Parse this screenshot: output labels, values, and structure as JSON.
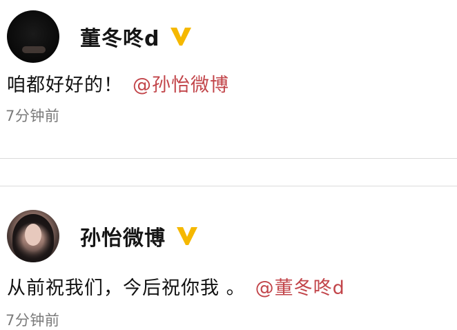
{
  "posts": [
    {
      "author": "董冬咚d",
      "verified_icon": "v-badge-icon",
      "text": "咱都好好的！",
      "mention": "@孙怡微博",
      "time": "7分钟前"
    },
    {
      "author": "孙怡微博",
      "verified_icon": "v-badge-icon",
      "text": "从前祝我们，今后祝你我 。",
      "mention": "@董冬咚d",
      "time": "7分钟前"
    }
  ],
  "colors": {
    "mention": "#c2454a",
    "verified": "#f5b800",
    "time": "#7a7a7a"
  }
}
